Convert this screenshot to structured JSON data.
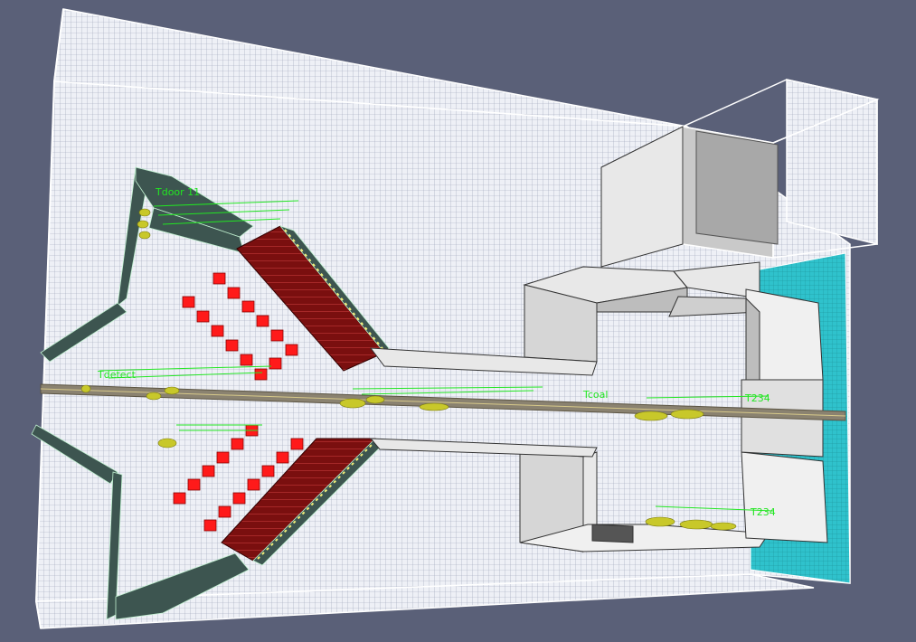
{
  "viewport": {
    "labels": {
      "door_top": "Tdoor 11",
      "probe_a": "Tdetect",
      "probe_b": "Tcoal",
      "probe_c": "T234",
      "probe_d": "T234"
    }
  },
  "colors": {
    "background": "#5a6078",
    "mesh": "#e6e9f2",
    "wall_white": "#f2f2f2",
    "stair_dark": "#3d5550",
    "stair_red": "#7a0f0f",
    "block_red": "#ff1a1a",
    "cyan_wall": "#2fc2cc",
    "label_green": "#22e622",
    "sensor_yellow": "#c8c82a"
  }
}
